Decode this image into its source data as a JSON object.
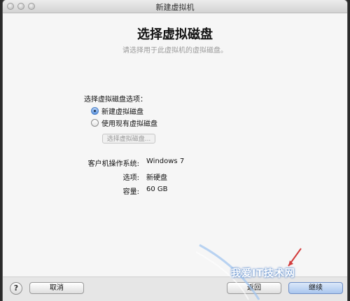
{
  "window": {
    "title": "新建虚拟机"
  },
  "page": {
    "title": "选择虚拟磁盘",
    "subtitle": "请选择用于此虚拟机的虚拟磁盘。"
  },
  "disk_options": {
    "label": "选择虚拟磁盘选项：",
    "options": [
      {
        "label": "新建虚拟磁盘",
        "selected": true
      },
      {
        "label": "使用现有虚拟磁盘",
        "selected": false
      }
    ],
    "choose_button": "选择虚拟磁盘..."
  },
  "summary": {
    "rows": [
      {
        "label": "客户机操作系统:",
        "value": "Windows 7"
      },
      {
        "label": "选项:",
        "value": "新硬盘"
      },
      {
        "label": "容量:",
        "value": "60 GB"
      }
    ]
  },
  "footer": {
    "help_label": "?",
    "cancel_label": "取消",
    "back_label": "返回",
    "next_label": "继续"
  },
  "watermark": {
    "text": "我爱IT技术网"
  },
  "colors": {
    "accent": "#5c94e0"
  }
}
